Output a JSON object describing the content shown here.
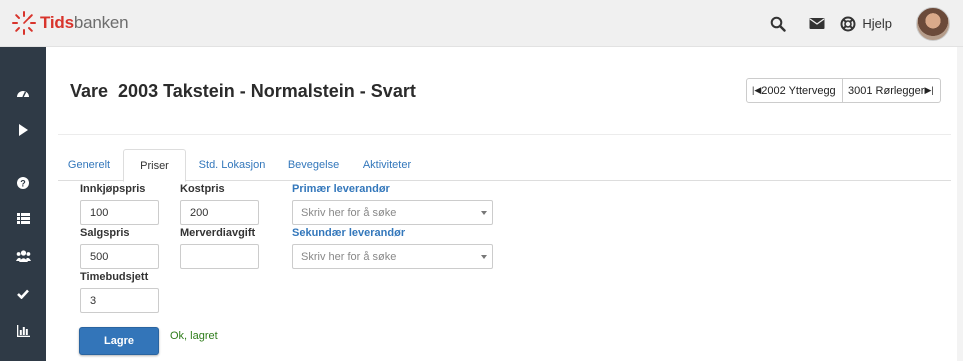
{
  "app": {
    "logo_brand": "Tids",
    "logo_rest": "banken",
    "brand_color": "#d8342c"
  },
  "header": {
    "icons": [
      "search-icon",
      "envelope-icon",
      "lifebuoy-icon"
    ],
    "help_label": "Hjelp"
  },
  "sidebar": {
    "items": [
      "dashboard-icon",
      "play-icon",
      "question-icon",
      "list-icon",
      "users-icon",
      "check-icon",
      "bar-chart-icon"
    ]
  },
  "page": {
    "title": "Vare  2003 Takstein - Normalstein - Svart",
    "prev_label": "2002 Yttervegg",
    "next_label": "3001 Rørlegger"
  },
  "tabs": [
    {
      "label": "Generelt",
      "active": false
    },
    {
      "label": "Priser",
      "active": true
    },
    {
      "label": "Std. Lokasjon",
      "active": false
    },
    {
      "label": "Bevegelse",
      "active": false
    },
    {
      "label": "Aktiviteter",
      "active": false
    }
  ],
  "form": {
    "innkjopspris_label": "Innkjøpspris",
    "innkjopspris_value": "100",
    "kostpris_label": "Kostpris",
    "kostpris_value": "200",
    "primaer_label": "Primær leverandør",
    "primaer_placeholder": "Skriv her for å søke",
    "salgspris_label": "Salgspris",
    "salgspris_value": "500",
    "mva_label": "Merverdiavgift",
    "mva_value": "",
    "sekundaer_label": "Sekundær leverandør",
    "sekundaer_placeholder": "Skriv her for å søke",
    "timebudsjett_label": "Timebudsjett",
    "timebudsjett_value": "3"
  },
  "actions": {
    "save_label": "Lagre",
    "status_text": "Ok, lagret",
    "primary_color": "#3375b9",
    "status_color": "#2e7d1a"
  }
}
